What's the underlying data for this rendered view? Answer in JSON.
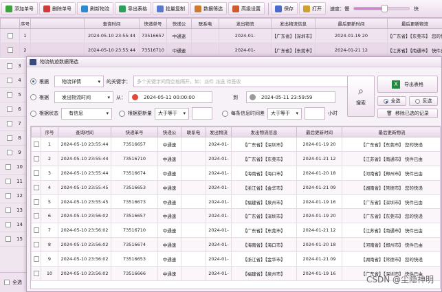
{
  "toolbar": {
    "buttons": [
      {
        "label": "添加单号",
        "color": "#3aa63a"
      },
      {
        "label": "删除单号",
        "color": "#d03a3a"
      },
      {
        "label": "刷新物流",
        "color": "#2e8ad0"
      },
      {
        "label": "导出表格",
        "color": "#2ea05a"
      },
      {
        "label": "批量复制",
        "color": "#5a7ad0"
      },
      {
        "label": "数据筛选",
        "color": "#d07a2e"
      },
      {
        "label": "高级设置",
        "color": "#d05a2e"
      },
      {
        "label": "保存",
        "color": "#4a6ad0"
      },
      {
        "label": "打开",
        "color": "#d0a02e"
      }
    ],
    "speed_label": "速度：慢",
    "speed_level": 0.55,
    "speed_right": "快"
  },
  "main_table": {
    "headers": [
      "序号",
      "查询时间",
      "快递单号",
      "快递公",
      "联系电",
      "发出物流",
      "发出物流信息",
      "最后更新时间",
      "最后更新物流",
      "状态1"
    ],
    "rows": [
      [
        "1",
        "2024-05-10 23:55:44",
        "73516657",
        "中通速",
        "",
        "2024-01-",
        "【广东省】【深圳市】",
        "2024-01-19 20",
        "【广东省】【东莞市】 您的快递",
        "签收"
      ],
      [
        "2",
        "2024-05-10 23:55:44",
        "73516710",
        "中通速",
        "",
        "2024-01-",
        "【广东省】【东莞市】",
        "2024-01-21 12",
        "【江苏省】【南通市】 快件已由",
        "签收"
      ]
    ]
  },
  "sidebar": {
    "rows": [
      "3",
      "4",
      "5",
      "6",
      "7",
      "8",
      "9",
      "10",
      "11",
      "12",
      "13",
      "14",
      "15"
    ]
  },
  "bottom": {
    "select_all": "全选"
  },
  "dialog": {
    "title": "物流轨迹数据筛选",
    "filter1": {
      "label": "根据",
      "field": "物流详情",
      "keyword_label": "的关键字：",
      "placeholder": "多个关键字间用空格隔开，如：派件 派送 待签收"
    },
    "filter2": {
      "label": "根据",
      "field": "发出物流时间",
      "from_label": "从：",
      "from": "2024-05-11 00:00:00",
      "to_label": "到",
      "to": "2024-05-11 23:59:59"
    },
    "filter3": {
      "label": "根据状态",
      "status": "有信息",
      "update_label": "根据更新量",
      "update_op": "大于等于",
      "interval_label": "每条信息时间差",
      "interval_op": "大于等于",
      "unit": "小时"
    },
    "search_btn": "搜索",
    "export_btn": "导出表格",
    "select_all": "全选",
    "invert": "反选",
    "remove_selected": "移除已选的记录",
    "grid": {
      "headers": [
        "序号",
        "查询时间",
        "快递单号",
        "快递公",
        "联系电",
        "发出物流",
        "发出物流信息",
        "最后更新时间",
        "最后更新物流"
      ],
      "rows": [
        [
          "1",
          "2024-05-10 23:55:44",
          "73516657",
          "中通速",
          "",
          "2024-01-",
          "【广东省】【深圳市】",
          "2024-01-19 20",
          "【广东省】【东莞市】 您的快递"
        ],
        [
          "2",
          "2024-05-10 23:55:44",
          "73516710",
          "中通速",
          "",
          "2024-01-",
          "【广东省】【东莞市】",
          "2024-01-21 12",
          "【江苏省】【南通市】 快件已由"
        ],
        [
          "3",
          "2024-05-10 23:55:44",
          "73516674",
          "中通速",
          "",
          "2024-01-",
          "【海南省】【海口市】",
          "2024-01-20 18",
          "【河南省】【郑州市】 快件已由"
        ],
        [
          "4",
          "2024-05-10 23:55:45",
          "73516653",
          "中通速",
          "",
          "2024-01-",
          "【浙江省】【金华市】",
          "2024-01-21 09",
          "【湖南省】【常德市】 您的快递"
        ],
        [
          "5",
          "2024-05-10 23:55:45",
          "73516673",
          "中通速",
          "",
          "2024-01-",
          "【福建省】【泉州市】",
          "2024-01-19 16",
          "【广东省】【深圳市】 快件已由"
        ],
        [
          "6",
          "2024-05-10 23:56:02",
          "73516657",
          "中通速",
          "",
          "2024-01-",
          "【广东省】【深圳市】",
          "2024-01-19 20",
          "【广东省】【东莞市】 您的快递"
        ],
        [
          "7",
          "2024-05-10 23:56:02",
          "73516710",
          "中通速",
          "",
          "2024-01-",
          "【广东省】【东莞市】",
          "2024-01-21 12",
          "【江苏省】【南通市】 快件已由"
        ],
        [
          "8",
          "2024-05-10 23:56:02",
          "73516674",
          "中通速",
          "",
          "2024-01-",
          "【海南省】【海口市】",
          "2024-01-20 18",
          "【河南省】【郑州市】 快件已由"
        ],
        [
          "9",
          "2024-05-10 23:56:02",
          "73516653",
          "中通速",
          "",
          "2024-01-",
          "【浙江省】【金华市】",
          "2024-01-21 09",
          "【湖南省】【常德市】 您的快递"
        ],
        [
          "10",
          "2024-05-10 23:56:02",
          "73516666",
          "中通速",
          "",
          "2024-01-",
          "【福建省】【泉州市】",
          "2024-01-19 16",
          "【广东省】【深圳市】 快件已由"
        ]
      ]
    }
  },
  "watermark": "CSDN @尘隐神明"
}
